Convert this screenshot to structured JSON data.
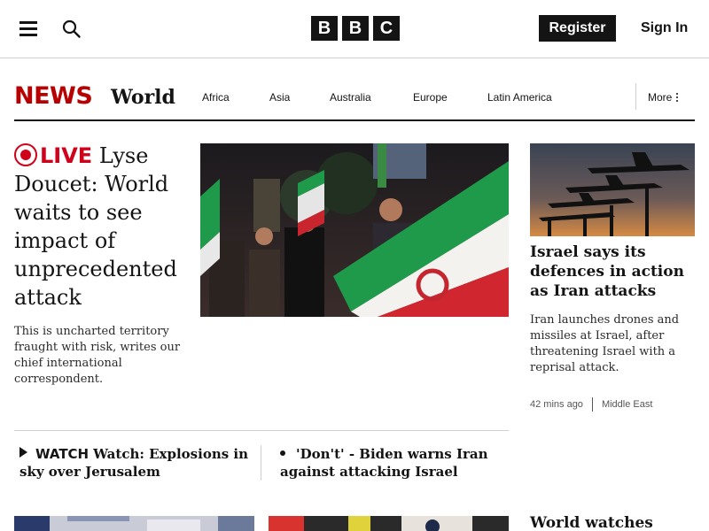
{
  "header": {
    "menu_icon": "hamburger-menu-icon",
    "search_icon": "search-icon",
    "logo_letters": [
      "B",
      "B",
      "C"
    ],
    "register_label": "Register",
    "signin_label": "Sign In"
  },
  "news_nav": {
    "brand": "NEWS",
    "brand_color": "#b80000",
    "section": "World",
    "links": [
      "Africa",
      "Asia",
      "Australia",
      "Europe",
      "Latin America"
    ],
    "more_label": "More",
    "more_icon": "kebab-icon"
  },
  "lead_story": {
    "live_label": "LIVE",
    "live_color": "#d0021b",
    "title": " Lyse Doucet: World waits to see impact of unprecedented attack",
    "summary": "This is uncharted territory fraught with risk, writes our chief international correspondent."
  },
  "side_story": {
    "title": "Israel says its defences in action as Iran attacks",
    "summary": "Iran launches drones and missiles at Israel, after threatening Israel with a reprisal attack.",
    "time": "42 mins ago",
    "tag": "Middle East"
  },
  "related": [
    {
      "label": "WATCH",
      "title": "Watch: Explosions in sky over Jerusalem"
    },
    {
      "title": "'Don't' - Biden warns Iran against attacking Israel"
    }
  ],
  "bottom_story": {
    "title": "World watches"
  }
}
